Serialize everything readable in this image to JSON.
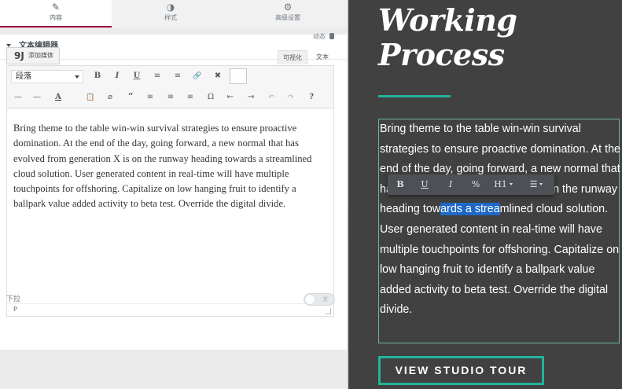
{
  "tabs": [
    {
      "label": "内容",
      "icon": "pencil-icon",
      "glyph": "✎"
    },
    {
      "label": "样式",
      "icon": "contrast-icon",
      "glyph": "◑"
    },
    {
      "label": "高级设置",
      "icon": "gear-icon",
      "glyph": "⚙"
    }
  ],
  "section": {
    "title": "文本编辑器"
  },
  "dynamic_label": "动态",
  "add_media": {
    "icon": "9J",
    "label": "添加媒体"
  },
  "view_tabs": {
    "visual": "可视化",
    "text": "文本"
  },
  "toolbar1": {
    "format_select": "段落",
    "bold": "B",
    "italic": "I",
    "underline": "U",
    "bullet_list": "≡",
    "numbered_list": "≡",
    "link": "🔗",
    "fullscreen": "✖"
  },
  "toolbar2": {
    "hr": "—",
    "text_color": "A",
    "paste": "📋",
    "clear": "⌀",
    "quote": "“",
    "align_left": "≡",
    "align_center": "≡",
    "align_right": "≡",
    "omega": "Ω",
    "outdent": "⇤",
    "indent": "⇥",
    "undo": "↶",
    "redo": "↷",
    "help": "?"
  },
  "editor_content": "Bring theme to the table win-win survival strategies to ensure proactive domination. At the end of the day, going forward, a new normal that has evolved from generation X is on the runway heading towards a streamlined cloud solution. User generated content in real-time will have multiple touchpoints for offshoring. Capitalize on low hanging fruit to identify a ballpark value added activity to beta test. Override the digital divide.",
  "status_path": "P",
  "dropdown": {
    "label": "下拉",
    "switch_label": "关"
  },
  "collapse_icon": "‹",
  "preview": {
    "heading_line1": "Working",
    "heading_line2": "Process",
    "accent_color": "#22b39c",
    "paragraph": {
      "before": "Bring theme to the table win-win survival strategies to ensure proactive domination. At the end of the day, going forward, a new normal that has evolved from generation X is on the runway heading tow",
      "selected": "ards a strea",
      "after": "mlined cloud solution. User generated content in real-time will have multiple touchpoints for offshoring. Capitalize on low hanging fruit to identify a ballpark value added activity to beta test. Override the digital divide."
    },
    "inline_toolbar": {
      "bold": "B",
      "underline": "U",
      "italic": "I",
      "link": "%",
      "heading": "H1",
      "list": "☰"
    },
    "cta_label": "VIEW STUDIO TOUR"
  }
}
